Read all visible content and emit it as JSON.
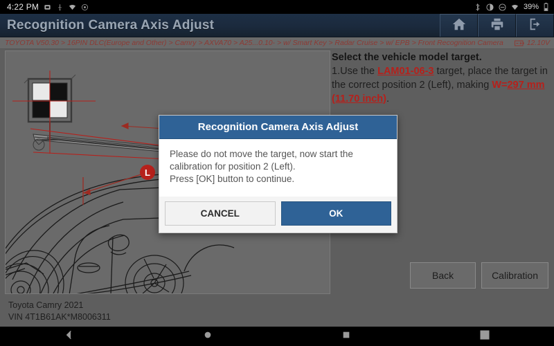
{
  "statusbar": {
    "time": "4:22 PM",
    "left_icons": [
      "sd-card-icon",
      "usb-icon",
      "wifi-weak-icon",
      "screen-record-icon"
    ],
    "right_icons": [
      "bluetooth-icon",
      "do-not-disturb-icon",
      "mute-icon",
      "wifi-icon"
    ],
    "battery_percent": "39%"
  },
  "titlebar": {
    "title": "Recognition Camera Axis Adjust",
    "buttons": [
      {
        "name": "home-button",
        "icon": "home-icon"
      },
      {
        "name": "print-button",
        "icon": "printer-icon"
      },
      {
        "name": "exit-button",
        "icon": "exit-icon"
      }
    ]
  },
  "breadcrumb": {
    "path": "TOYOTA V50.30 > 16PIN DLC(Europe and Other) > Camry > AXVA70 > A25...0.10- > w/ Smart Key > Radar Cruise > w/ EPB > Front Recognition Camera",
    "battery_icon": "battery-icon",
    "voltage": "12.10V"
  },
  "diagram": {
    "marker_label": "L",
    "alt": "vehicle-front-calibration-target-diagram"
  },
  "instructions": {
    "heading": "Select the vehicle model target.",
    "line_prefix": "1.Use the ",
    "target_code": "LAM01-06-3",
    "line_mid": " target, place the target in the correct position 2 (Left), making ",
    "w_label": "W=",
    "w_value": "297 mm (11.70 inch)",
    "line_end": "."
  },
  "actions": {
    "back_label": "Back",
    "calibration_label": "Calibration"
  },
  "vehicle_info": {
    "model": "Toyota Camry 2021",
    "vin": "VIN 4T1B61AK*M8006311"
  },
  "dialog": {
    "title": "Recognition Camera Axis Adjust",
    "line1": "Please do not move the target, now start the calibration for position 2 (Left).",
    "line2": "Press [OK] button to continue.",
    "cancel_label": "CANCEL",
    "ok_label": "OK"
  },
  "navbar": {
    "buttons": [
      {
        "name": "nav-back-button",
        "icon": "chevron-left-icon"
      },
      {
        "name": "nav-home-button",
        "icon": "circle-icon"
      },
      {
        "name": "nav-recents-button",
        "icon": "square-icon"
      },
      {
        "name": "nav-screenshot-button",
        "icon": "screenshot-icon"
      }
    ]
  },
  "colors": {
    "accent_blue": "#2f6296",
    "breadcrumb_red": "#8d3a34",
    "highlight_red": "#b6201b",
    "panel_gray": "#6a6a6a"
  }
}
